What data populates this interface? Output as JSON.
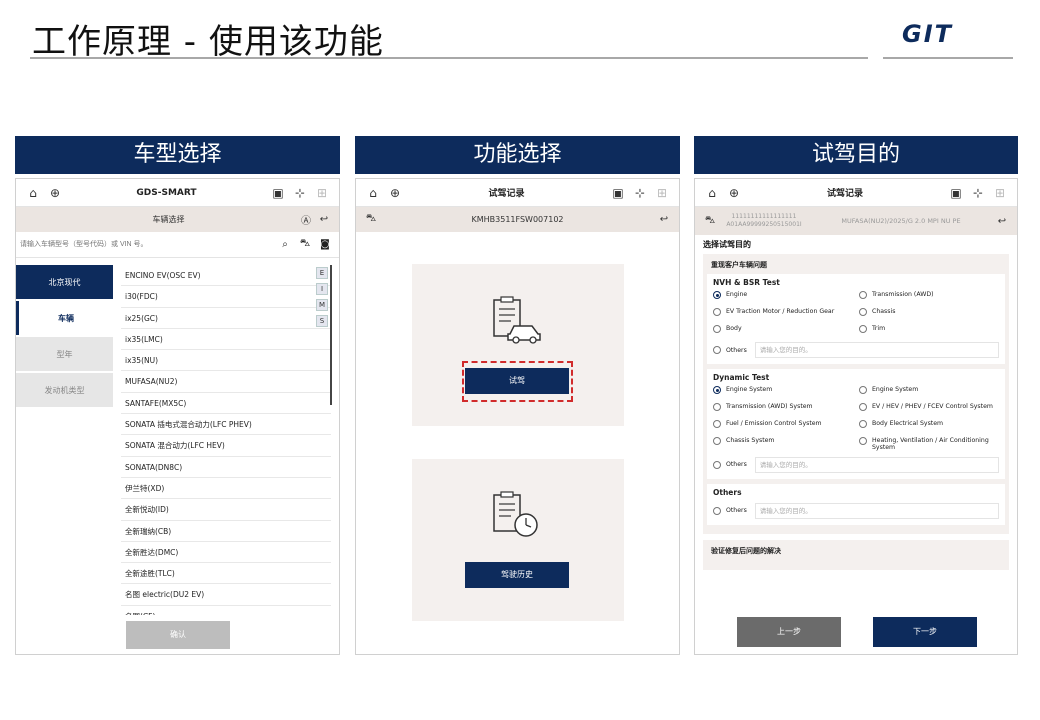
{
  "slide": {
    "title": "工作原理 - 使用该功能",
    "logo": "GIT"
  },
  "columns": {
    "col1": "车型选择",
    "col2": "功能选择",
    "col3": "试驾目的"
  },
  "phone1": {
    "app_title": "GDS-SMART",
    "sub_title": "车辆选择",
    "search_placeholder": "请输入车辆型号（型号代码）或 VIN 号。",
    "brands": [
      "北京现代",
      "车辆",
      "型年",
      "发动机类型"
    ],
    "models": [
      "ENCINO EV(OSC EV)",
      "i30(FDC)",
      "ix25(GC)",
      "ix35(LMC)",
      "ix35(NU)",
      "MUFASA(NU2)",
      "SANTAFE(MX5C)",
      "SONATA 插电式混合动力(LFC PHEV)",
      "SONATA 混合动力(LFC HEV)",
      "SONATA(DN8C)",
      "伊兰特(XD)",
      "全新悦动(ID)",
      "全新瑞纳(CB)",
      "全新胜达(DMC)",
      "全新途胜(TLC)",
      "名图 electric(DU2 EV)",
      "名图(CF)"
    ],
    "alphabet": [
      "E",
      "I",
      "M",
      "S"
    ],
    "confirm": "确认"
  },
  "phone2": {
    "title": "试驾记录",
    "vin": "KMHB3511FSW007102",
    "test_drive": "试驾",
    "history": "驾驶历史"
  },
  "phone3": {
    "title": "试驾记录",
    "vin_line": "11111111111111111",
    "vin_sub": "A01AA99999250515001I",
    "vehicle": "MUFASA(NU2)/2025/G 2.0 MPI NU PE",
    "select_purpose": "选择试驾目的",
    "reproduce_label": "重现客户车辆问题",
    "nvh": {
      "title": "NVH & BSR Test",
      "options": [
        "Engine",
        "Transmission (AWD)",
        "EV Traction Motor / Reduction Gear",
        "Chassis",
        "Body",
        "Trim"
      ],
      "others": "Others",
      "placeholder": "请输入您的目的。"
    },
    "dynamic": {
      "title": "Dynamic Test",
      "options": [
        "Engine System",
        "Engine System",
        "Transmission (AWD) System",
        "EV / HEV / PHEV / FCEV Control System",
        "Fuel / Emission Control System",
        "Body Electrical System",
        "Chassis System",
        "Heating, Ventilation / Air Conditioning System"
      ],
      "others": "Others",
      "placeholder": "请输入您的目的。"
    },
    "others_box": {
      "title": "Others",
      "others": "Others",
      "placeholder": "请输入您的目的。"
    },
    "verify_label": "验证修复后问题的解决",
    "prev": "上一步",
    "next": "下一步"
  },
  "colors": {
    "navy": "#0d2b5c",
    "beige": "#ebe5e1",
    "red_dash": "#d12b2b",
    "gray_btn": "#6b6b6b"
  }
}
